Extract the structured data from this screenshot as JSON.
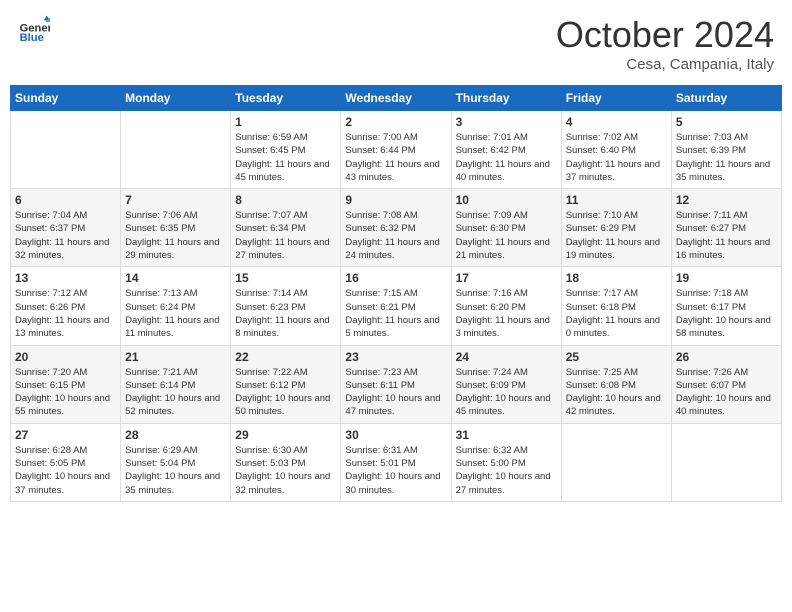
{
  "header": {
    "logo_general": "General",
    "logo_blue": "Blue",
    "month_title": "October 2024",
    "subtitle": "Cesa, Campania, Italy"
  },
  "weekdays": [
    "Sunday",
    "Monday",
    "Tuesday",
    "Wednesday",
    "Thursday",
    "Friday",
    "Saturday"
  ],
  "weeks": [
    [
      {
        "day": null,
        "info": ""
      },
      {
        "day": null,
        "info": ""
      },
      {
        "day": "1",
        "info": "Sunrise: 6:59 AM\nSunset: 6:45 PM\nDaylight: 11 hours and 45 minutes."
      },
      {
        "day": "2",
        "info": "Sunrise: 7:00 AM\nSunset: 6:44 PM\nDaylight: 11 hours and 43 minutes."
      },
      {
        "day": "3",
        "info": "Sunrise: 7:01 AM\nSunset: 6:42 PM\nDaylight: 11 hours and 40 minutes."
      },
      {
        "day": "4",
        "info": "Sunrise: 7:02 AM\nSunset: 6:40 PM\nDaylight: 11 hours and 37 minutes."
      },
      {
        "day": "5",
        "info": "Sunrise: 7:03 AM\nSunset: 6:39 PM\nDaylight: 11 hours and 35 minutes."
      }
    ],
    [
      {
        "day": "6",
        "info": "Sunrise: 7:04 AM\nSunset: 6:37 PM\nDaylight: 11 hours and 32 minutes."
      },
      {
        "day": "7",
        "info": "Sunrise: 7:06 AM\nSunset: 6:35 PM\nDaylight: 11 hours and 29 minutes."
      },
      {
        "day": "8",
        "info": "Sunrise: 7:07 AM\nSunset: 6:34 PM\nDaylight: 11 hours and 27 minutes."
      },
      {
        "day": "9",
        "info": "Sunrise: 7:08 AM\nSunset: 6:32 PM\nDaylight: 11 hours and 24 minutes."
      },
      {
        "day": "10",
        "info": "Sunrise: 7:09 AM\nSunset: 6:30 PM\nDaylight: 11 hours and 21 minutes."
      },
      {
        "day": "11",
        "info": "Sunrise: 7:10 AM\nSunset: 6:29 PM\nDaylight: 11 hours and 19 minutes."
      },
      {
        "day": "12",
        "info": "Sunrise: 7:11 AM\nSunset: 6:27 PM\nDaylight: 11 hours and 16 minutes."
      }
    ],
    [
      {
        "day": "13",
        "info": "Sunrise: 7:12 AM\nSunset: 6:26 PM\nDaylight: 11 hours and 13 minutes."
      },
      {
        "day": "14",
        "info": "Sunrise: 7:13 AM\nSunset: 6:24 PM\nDaylight: 11 hours and 11 minutes."
      },
      {
        "day": "15",
        "info": "Sunrise: 7:14 AM\nSunset: 6:23 PM\nDaylight: 11 hours and 8 minutes."
      },
      {
        "day": "16",
        "info": "Sunrise: 7:15 AM\nSunset: 6:21 PM\nDaylight: 11 hours and 5 minutes."
      },
      {
        "day": "17",
        "info": "Sunrise: 7:16 AM\nSunset: 6:20 PM\nDaylight: 11 hours and 3 minutes."
      },
      {
        "day": "18",
        "info": "Sunrise: 7:17 AM\nSunset: 6:18 PM\nDaylight: 11 hours and 0 minutes."
      },
      {
        "day": "19",
        "info": "Sunrise: 7:18 AM\nSunset: 6:17 PM\nDaylight: 10 hours and 58 minutes."
      }
    ],
    [
      {
        "day": "20",
        "info": "Sunrise: 7:20 AM\nSunset: 6:15 PM\nDaylight: 10 hours and 55 minutes."
      },
      {
        "day": "21",
        "info": "Sunrise: 7:21 AM\nSunset: 6:14 PM\nDaylight: 10 hours and 52 minutes."
      },
      {
        "day": "22",
        "info": "Sunrise: 7:22 AM\nSunset: 6:12 PM\nDaylight: 10 hours and 50 minutes."
      },
      {
        "day": "23",
        "info": "Sunrise: 7:23 AM\nSunset: 6:11 PM\nDaylight: 10 hours and 47 minutes."
      },
      {
        "day": "24",
        "info": "Sunrise: 7:24 AM\nSunset: 6:09 PM\nDaylight: 10 hours and 45 minutes."
      },
      {
        "day": "25",
        "info": "Sunrise: 7:25 AM\nSunset: 6:08 PM\nDaylight: 10 hours and 42 minutes."
      },
      {
        "day": "26",
        "info": "Sunrise: 7:26 AM\nSunset: 6:07 PM\nDaylight: 10 hours and 40 minutes."
      }
    ],
    [
      {
        "day": "27",
        "info": "Sunrise: 6:28 AM\nSunset: 5:05 PM\nDaylight: 10 hours and 37 minutes."
      },
      {
        "day": "28",
        "info": "Sunrise: 6:29 AM\nSunset: 5:04 PM\nDaylight: 10 hours and 35 minutes."
      },
      {
        "day": "29",
        "info": "Sunrise: 6:30 AM\nSunset: 5:03 PM\nDaylight: 10 hours and 32 minutes."
      },
      {
        "day": "30",
        "info": "Sunrise: 6:31 AM\nSunset: 5:01 PM\nDaylight: 10 hours and 30 minutes."
      },
      {
        "day": "31",
        "info": "Sunrise: 6:32 AM\nSunset: 5:00 PM\nDaylight: 10 hours and 27 minutes."
      },
      {
        "day": null,
        "info": ""
      },
      {
        "day": null,
        "info": ""
      }
    ]
  ]
}
